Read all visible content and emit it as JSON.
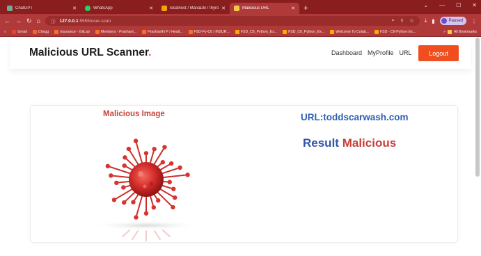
{
  "browser": {
    "tabs": [
      {
        "title": "ChatGPT",
        "favicon_color": "#74aa9c",
        "active": false
      },
      {
        "title": "WhatsApp",
        "favicon_color": "#25d366",
        "active": false
      },
      {
        "title": "localhost / MariaDB / thyroid_d",
        "favicon_color": "#f0a30a",
        "active": false
      },
      {
        "title": "Malicious URL",
        "favicon_color": "#f7c948",
        "active": true
      }
    ],
    "new_tab": "+",
    "address": {
      "host": "127.0.0.1",
      "path": ":5555/user-scan"
    },
    "profile_label": "Paused",
    "bookmarks": [
      {
        "label": "Gmail",
        "color": "#ea4335"
      },
      {
        "label": "Chegg",
        "color": "#f26522"
      },
      {
        "label": "Insurance - GitLab",
        "color": "#fc6d26"
      },
      {
        "label": "Members - Prashant...",
        "color": "#fc6d26"
      },
      {
        "label": "Prashanthi P / Healt...",
        "color": "#fc6d26"
      },
      {
        "label": "FSD-Py-C6 / INSUR...",
        "color": "#fc6d26"
      },
      {
        "label": "FSD_C6_Python_Ex...",
        "color": "#f9ab00"
      },
      {
        "label": "FSD_C6_Python_Ex...",
        "color": "#f9ab00"
      },
      {
        "label": "Welcome To Colab...",
        "color": "#f9ab00"
      },
      {
        "label": "FSD - C6-Python Ex...",
        "color": "#f9ab00"
      }
    ],
    "all_bookmarks": "All Bookmarks"
  },
  "page": {
    "brand": "Malicious URL Scanner",
    "brand_dot": ".",
    "nav": [
      "Dashboard",
      "MyProfile",
      "URL"
    ],
    "logout": "Logout",
    "card": {
      "image_title": "Malicious Image",
      "url_text": "URL:toddscarwash.com",
      "result_label": "Result",
      "result_value": "Malicious"
    }
  },
  "colors": {
    "chrome_frame": "#8a1e1e",
    "chrome_toolbar": "#b03a3a",
    "accent": "#f04e1f",
    "url_blue": "#2e5fb4",
    "malicious_red": "#c9403b"
  }
}
